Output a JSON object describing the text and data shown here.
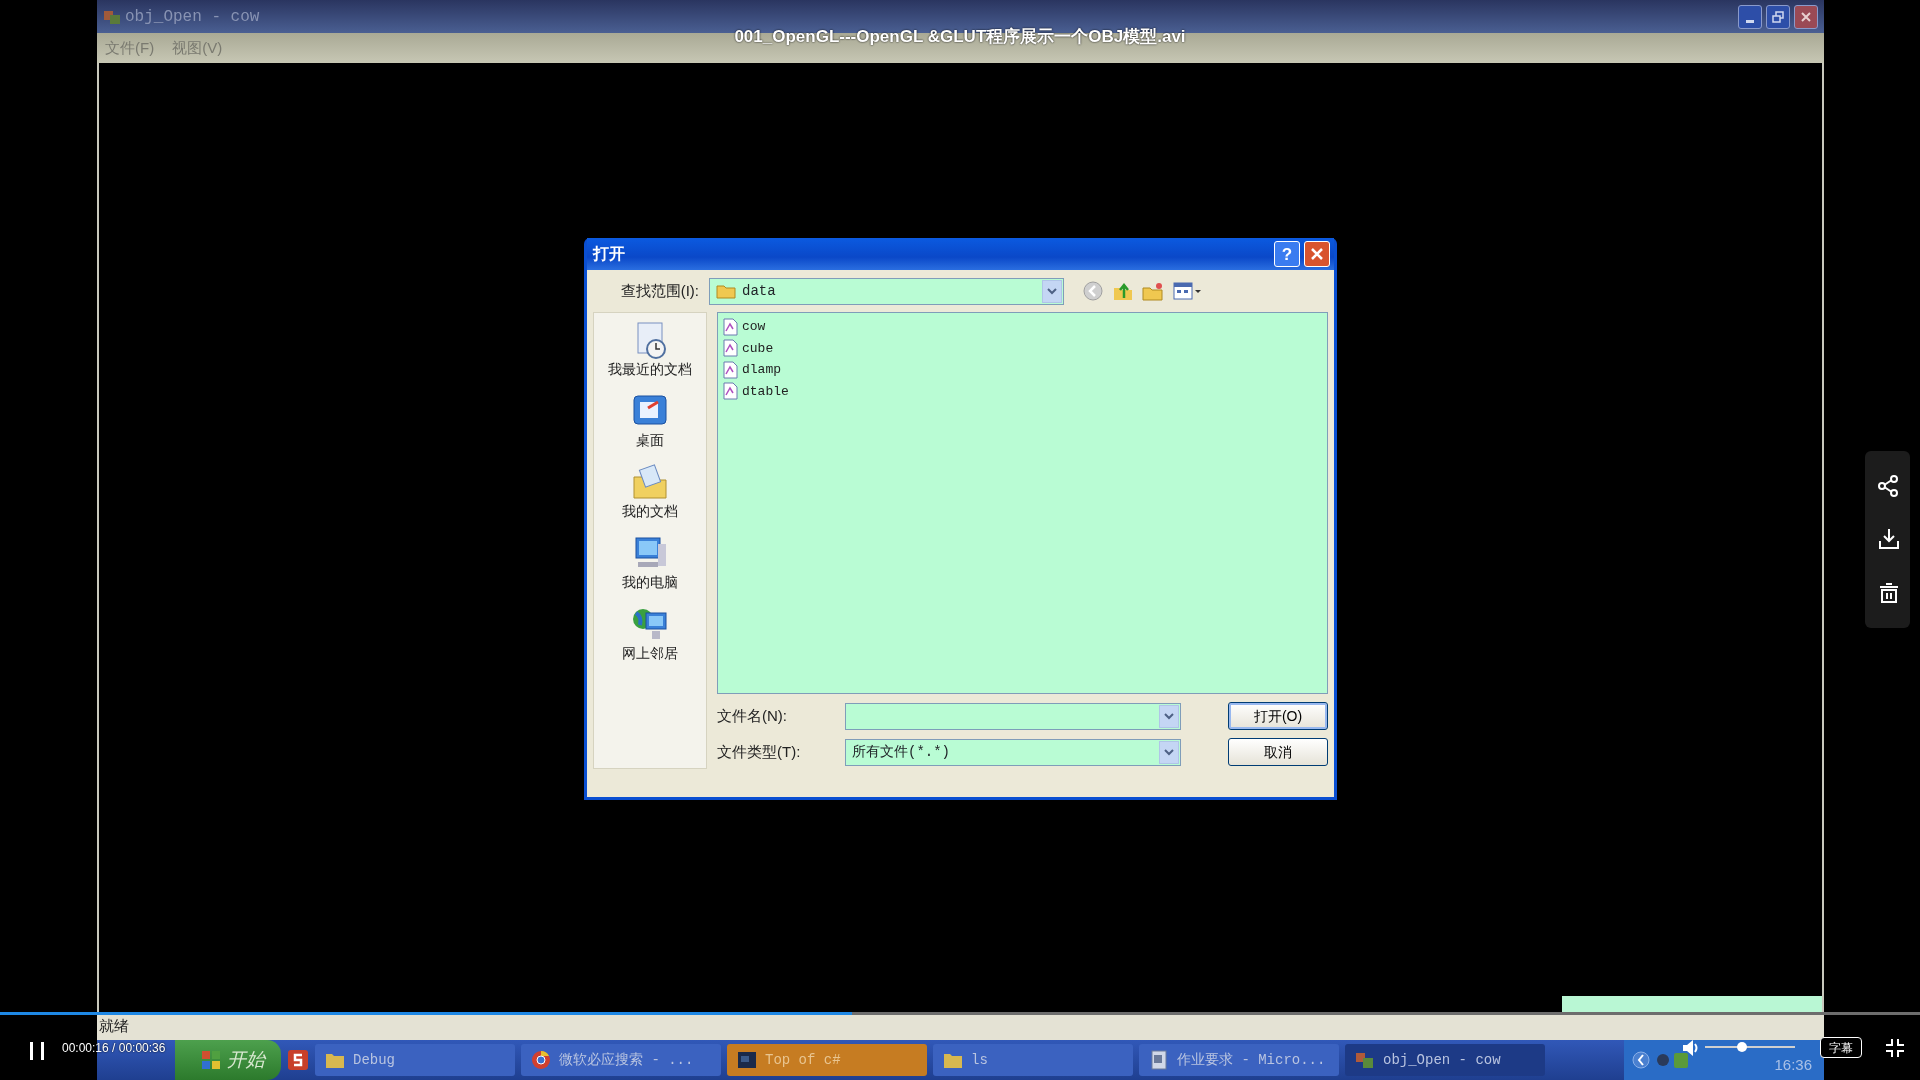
{
  "player": {
    "title": "001_OpenGL---OpenGL &GLUT程序展示一个OBJ模型.avi",
    "playing": true,
    "progress": {
      "level": 0.444
    },
    "time": "00:00:16 / 00:00:36",
    "volume": {
      "level": 0.41
    },
    "subtitle_button": "字幕"
  },
  "window": {
    "title": "obj_Open - cow",
    "menu": [
      "文件(F)",
      "视图(V)"
    ],
    "status": "就绪"
  },
  "dialog": {
    "title": "打开",
    "help_button": "?",
    "look_in_label": "查找范围(I):",
    "look_in_value": "data",
    "places": [
      "我最近的文档",
      "桌面",
      "我的文档",
      "我的电脑",
      "网上邻居"
    ],
    "files": [
      "cow",
      "cube",
      "dlamp",
      "dtable"
    ],
    "filename_label": "文件名(N):",
    "filetype_label": "文件类型(T):",
    "filetype_value": "所有文件(*.*)",
    "buttons": [
      "打开(O)",
      "取消"
    ]
  },
  "taskbar": {
    "start": "开始",
    "items": [
      {
        "label": "Debug",
        "kind": "normal"
      },
      {
        "label": "微软必应搜索 - ...",
        "kind": "normal"
      },
      {
        "label": "Top of c#",
        "kind": "flashing"
      },
      {
        "label": "ls",
        "kind": "normal"
      },
      {
        "label": "作业要求 - Micro...",
        "kind": "normal"
      },
      {
        "label": "obj_Open - cow",
        "kind": "active"
      }
    ],
    "clock": "16:36"
  }
}
